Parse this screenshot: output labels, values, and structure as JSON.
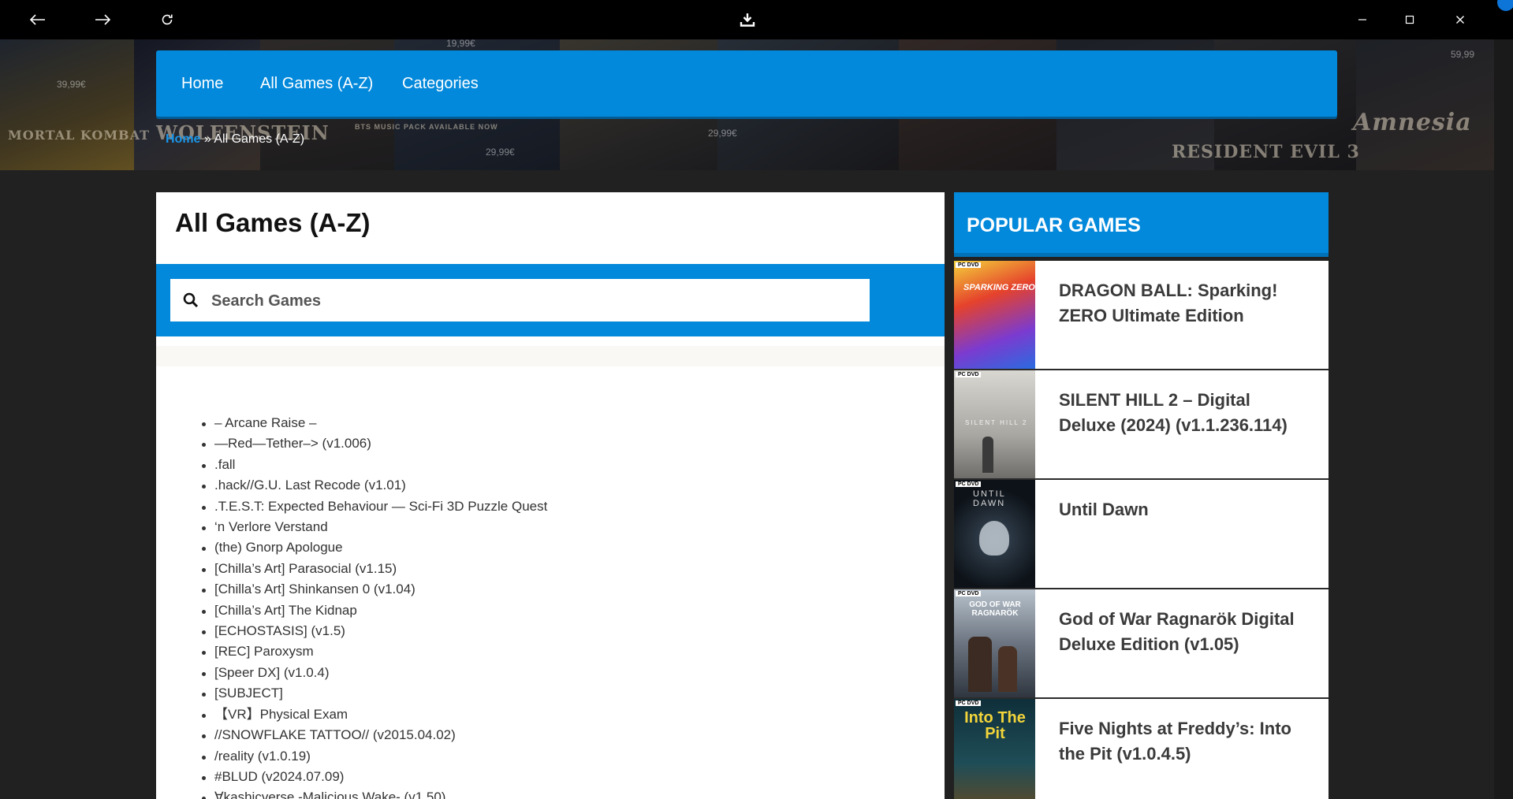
{
  "titlebar": {
    "back_icon": "arrow-left-icon",
    "forward_icon": "arrow-right-icon",
    "reload_icon": "reload-icon",
    "download_icon": "download-icon",
    "minimize_icon": "minimize-icon",
    "maximize_icon": "maximize-icon",
    "close_icon": "close-icon"
  },
  "hero": {
    "banner_texts": [
      "MORTAL KOMBAT",
      "WOLFENSTEIN",
      "BTS MUSIC PACK AVAILABLE NOW",
      "RESIDENT EVIL 3",
      "Amnesia"
    ],
    "prices": [
      "39,99€",
      "19,99€",
      "29,99€",
      "29,99€",
      "59,99"
    ]
  },
  "nav": {
    "items": [
      "Home",
      "All Games (A-Z)",
      "Categories"
    ]
  },
  "breadcrumb": {
    "home": "Home",
    "separator": " » ",
    "current": "All Games (A-Z)"
  },
  "main": {
    "title": "All Games (A-Z)",
    "search_placeholder": "Search Games",
    "games": [
      "– Arcane Raise –",
      "—Red—Tether–> (v1.006)",
      ".fall",
      ".hack//G.U. Last Recode (v1.01)",
      ".T.E.S.T: Expected Behaviour — Sci-Fi 3D Puzzle Quest",
      "‘n Verlore Verstand",
      "(the) Gnorp Apologue",
      "[Chilla’s Art] Parasocial (v1.15)",
      "[Chilla’s Art] Shinkansen 0 (v1.04)",
      "[Chilla’s Art] The Kidnap",
      "[ECHOSTASIS] (v1.5)",
      "[REC] Paroxysm",
      "[Speer DX] (v1.0.4)",
      "[SUBJECT]",
      "【VR】Physical Exam",
      "//SNOWFLAKE TATTOO// (v2015.04.02)",
      "/reality (v1.0.19)",
      "#BLUD (v2024.07.09)",
      "∀kashicverse -Malicious Wake- (v1.50)"
    ]
  },
  "sidebar": {
    "heading": "POPULAR GAMES",
    "pc_tag": "PC DVD",
    "cover_texts": [
      "SPARKING ZERO",
      "SILENT HILL 2",
      "UNTIL DAWN",
      "GOD OF WAR RAGNARÖK",
      "Into The Pit"
    ],
    "items": [
      "DRAGON BALL: Sparking! ZERO Ultimate Edition",
      "SILENT HILL 2 – Digital Deluxe (2024) (v1.1.236.114)",
      "Until Dawn",
      "God of War Ragnarök Digital Deluxe Edition (v1.05)",
      "Five Nights at Freddy’s: Into the Pit (v1.0.4.5)"
    ]
  },
  "colors": {
    "accent": "#0389db",
    "background": "#212121",
    "titlebar": "#000000"
  }
}
